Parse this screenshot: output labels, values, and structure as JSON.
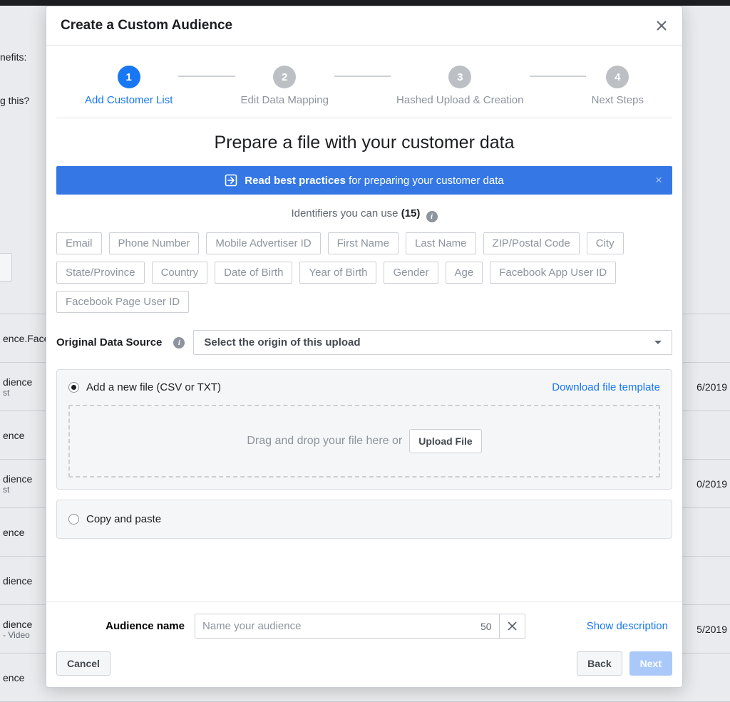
{
  "bg": {
    "left": [
      "nefits:",
      "g this?"
    ],
    "rows": [
      {
        "left": "ence.Face",
        "right": ""
      },
      {
        "left": "dience",
        "sub": "st",
        "right": "6/2019"
      },
      {
        "left": "ence",
        "right": ""
      },
      {
        "left": "dience",
        "sub": "st",
        "right": "0/2019"
      },
      {
        "left": "ence",
        "right": ""
      },
      {
        "left": "dience",
        "right": ""
      },
      {
        "left": "dience",
        "sub": " - Video",
        "right": "5/2019"
      },
      {
        "left": "ence",
        "right": ""
      }
    ]
  },
  "modal": {
    "title": "Create a Custom Audience",
    "steps": [
      {
        "num": "1",
        "label": "Add Customer List",
        "active": true
      },
      {
        "num": "2",
        "label": "Edit Data Mapping",
        "active": false
      },
      {
        "num": "3",
        "label": "Hashed Upload & Creation",
        "active": false
      },
      {
        "num": "4",
        "label": "Next Steps",
        "active": false
      }
    ],
    "heading": "Prepare a file with your customer data",
    "banner": {
      "bold": "Read best practices",
      "rest": " for preparing your customer data"
    },
    "identifiers_label_pre": "Identifiers you can use ",
    "identifiers_count": "(15)",
    "identifiers": [
      "Email",
      "Phone Number",
      "Mobile Advertiser ID",
      "First Name",
      "Last Name",
      "ZIP/Postal Code",
      "City",
      "State/Province",
      "Country",
      "Date of Birth",
      "Year of Birth",
      "Gender",
      "Age",
      "Facebook App User ID",
      "Facebook Page User ID"
    ],
    "data_source_label": "Original Data Source",
    "data_source_placeholder": "Select the origin of this upload",
    "file_option": {
      "label": "Add a new file (CSV or TXT)",
      "download_link": "Download file template",
      "drop_text": "Drag and drop your file here or",
      "upload_btn": "Upload File"
    },
    "paste_option": {
      "label": "Copy and paste"
    },
    "audience_name": {
      "label": "Audience name",
      "placeholder": "Name your audience",
      "count": "50",
      "show_desc": "Show description"
    },
    "buttons": {
      "cancel": "Cancel",
      "back": "Back",
      "next": "Next"
    }
  }
}
